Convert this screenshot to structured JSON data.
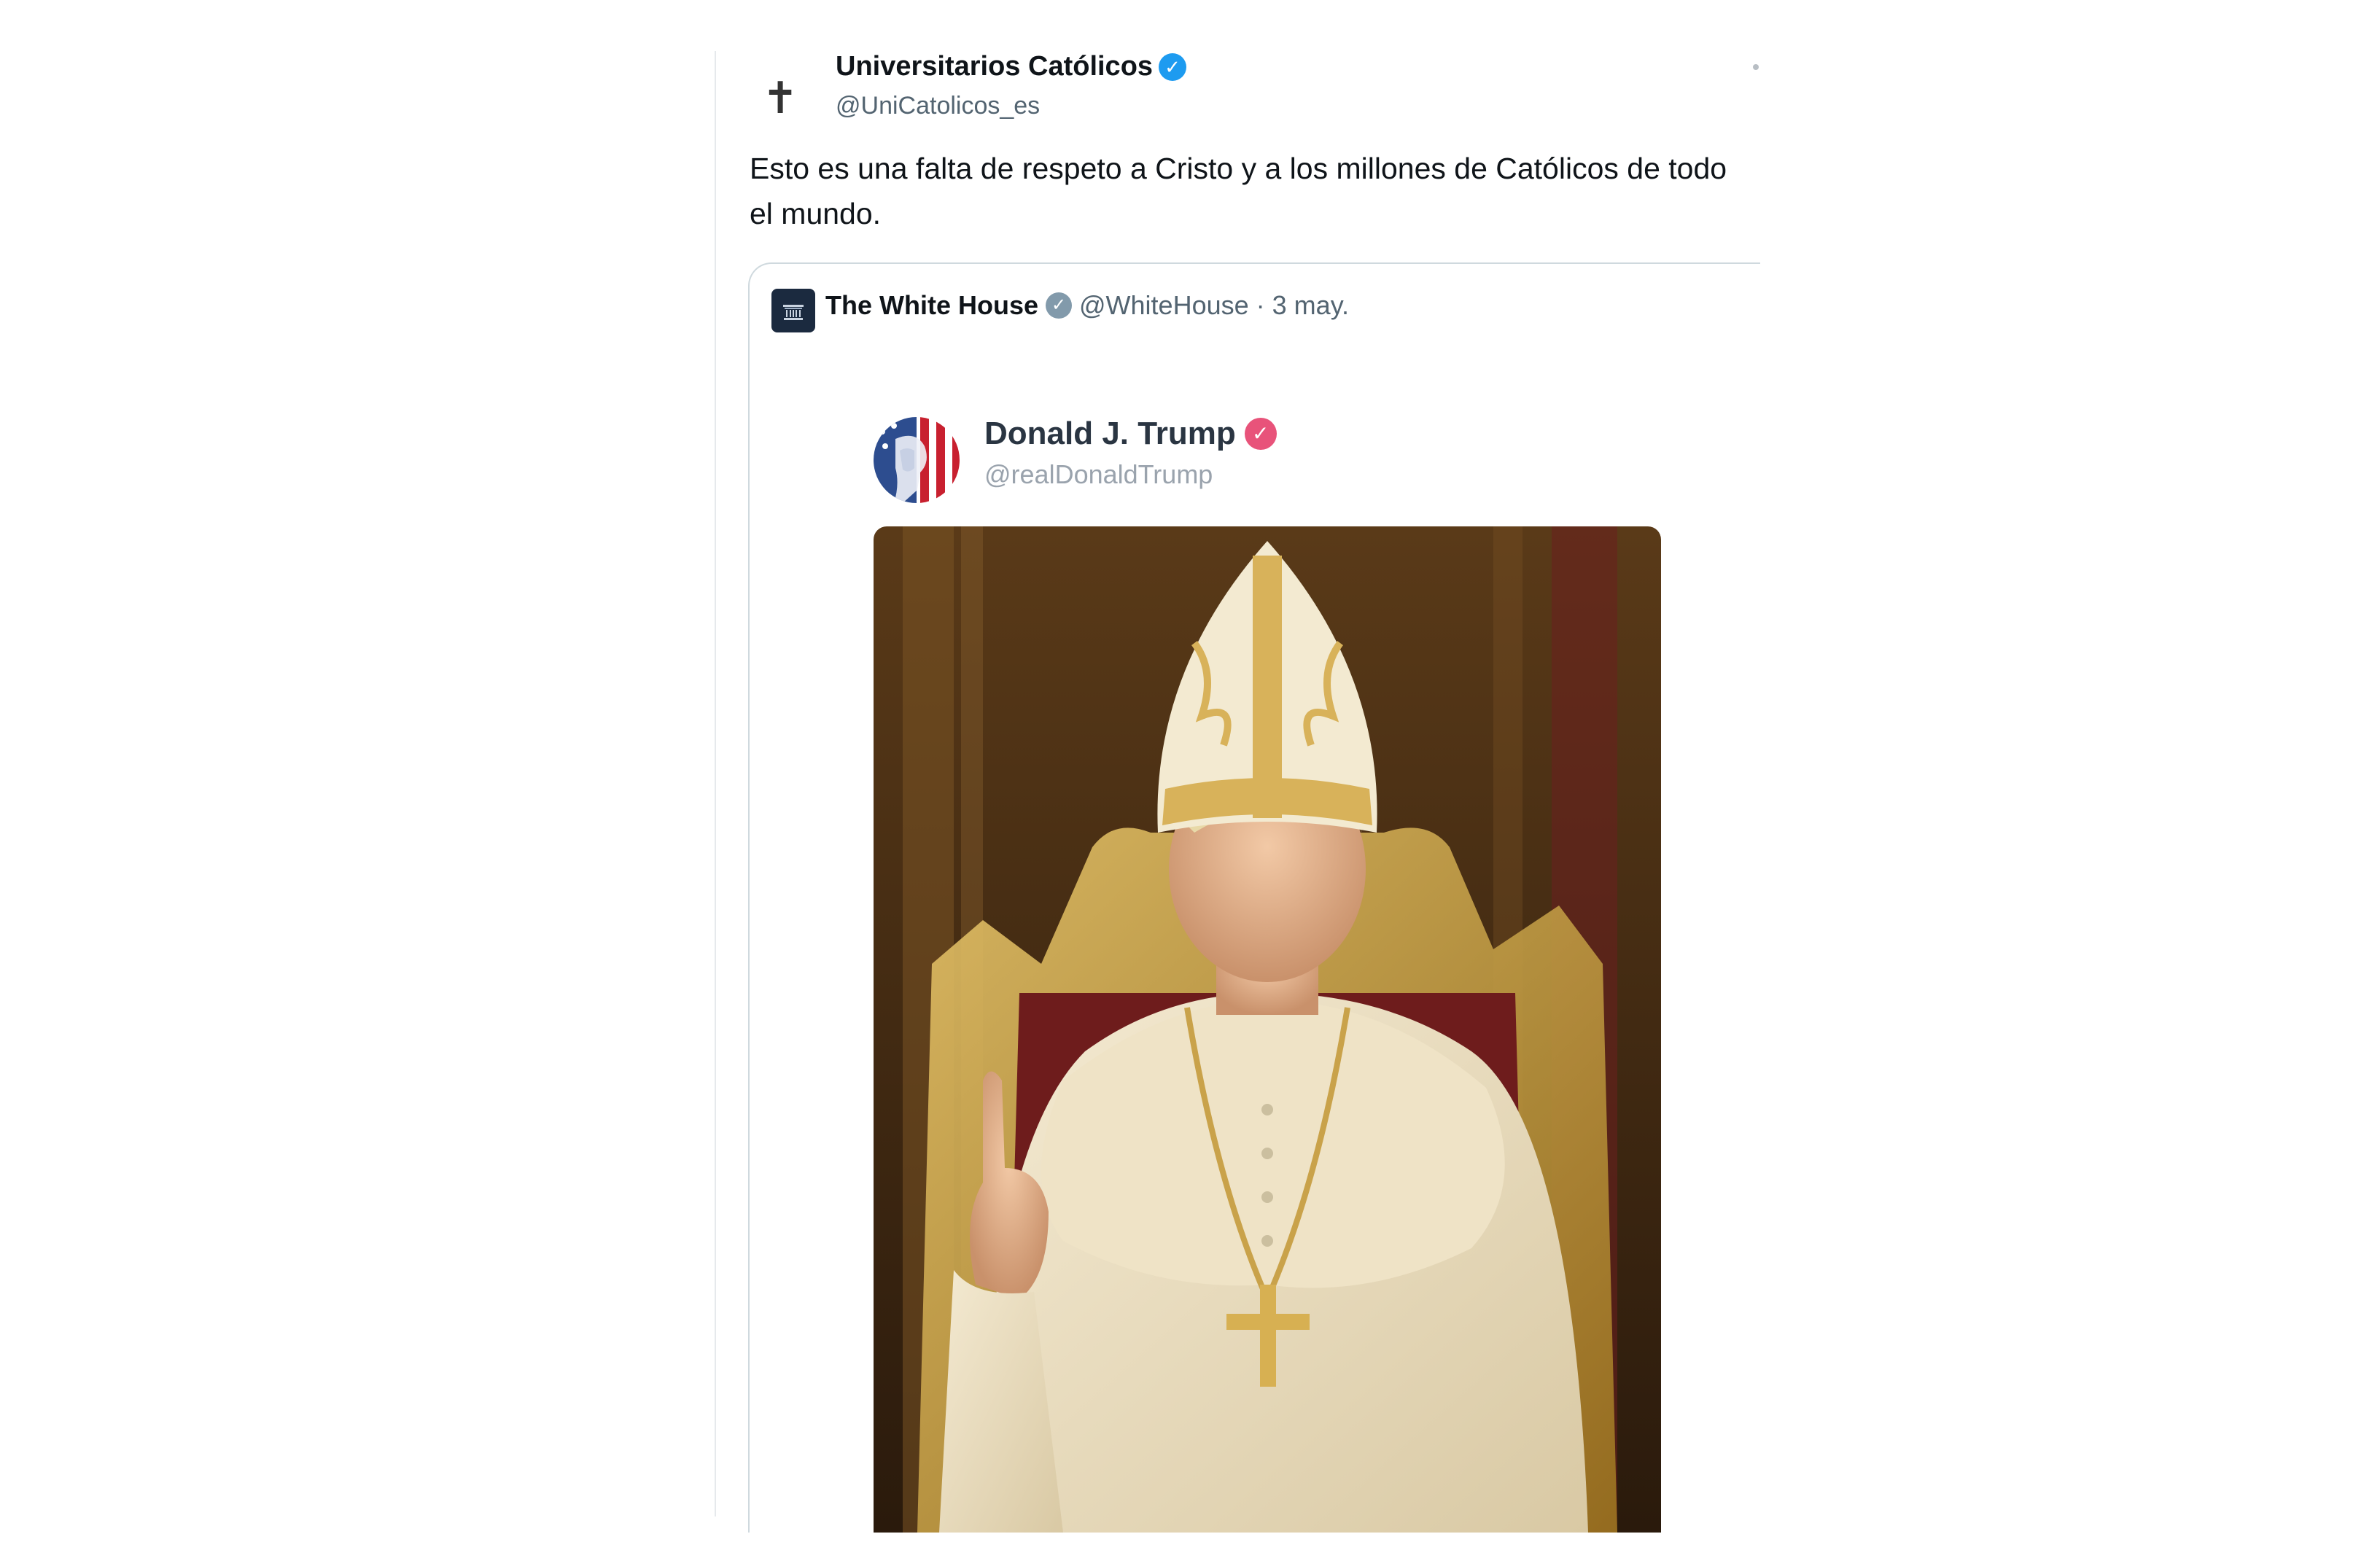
{
  "tweet": {
    "author_name": "Universitarios Católicos",
    "author_handle": "@UniCatolicos_es",
    "author_avatar_icon": "cross-icon",
    "verified_icon": "verified-badge-icon",
    "text": "Esto es una falta de respeto a Cristo y a los millones de Católicos de todo el mundo."
  },
  "quote": {
    "author_name": "The White House",
    "author_handle": "@WhiteHouse",
    "separator": "·",
    "date": "3 may.",
    "verified_icon": "verified-badge-icon",
    "inner_post": {
      "author_name": "Donald J. Trump",
      "author_handle": "@realDonaldTrump",
      "verified_icon": "verified-badge-icon",
      "image_icon": "pope-portrait-image"
    }
  },
  "colors": {
    "text_primary": "#0f1419",
    "text_secondary": "#536471",
    "verified_blue": "#1d9bf0",
    "verified_gray": "#829aab",
    "verified_pink": "#e8537a",
    "card_border": "#cfd9de"
  }
}
